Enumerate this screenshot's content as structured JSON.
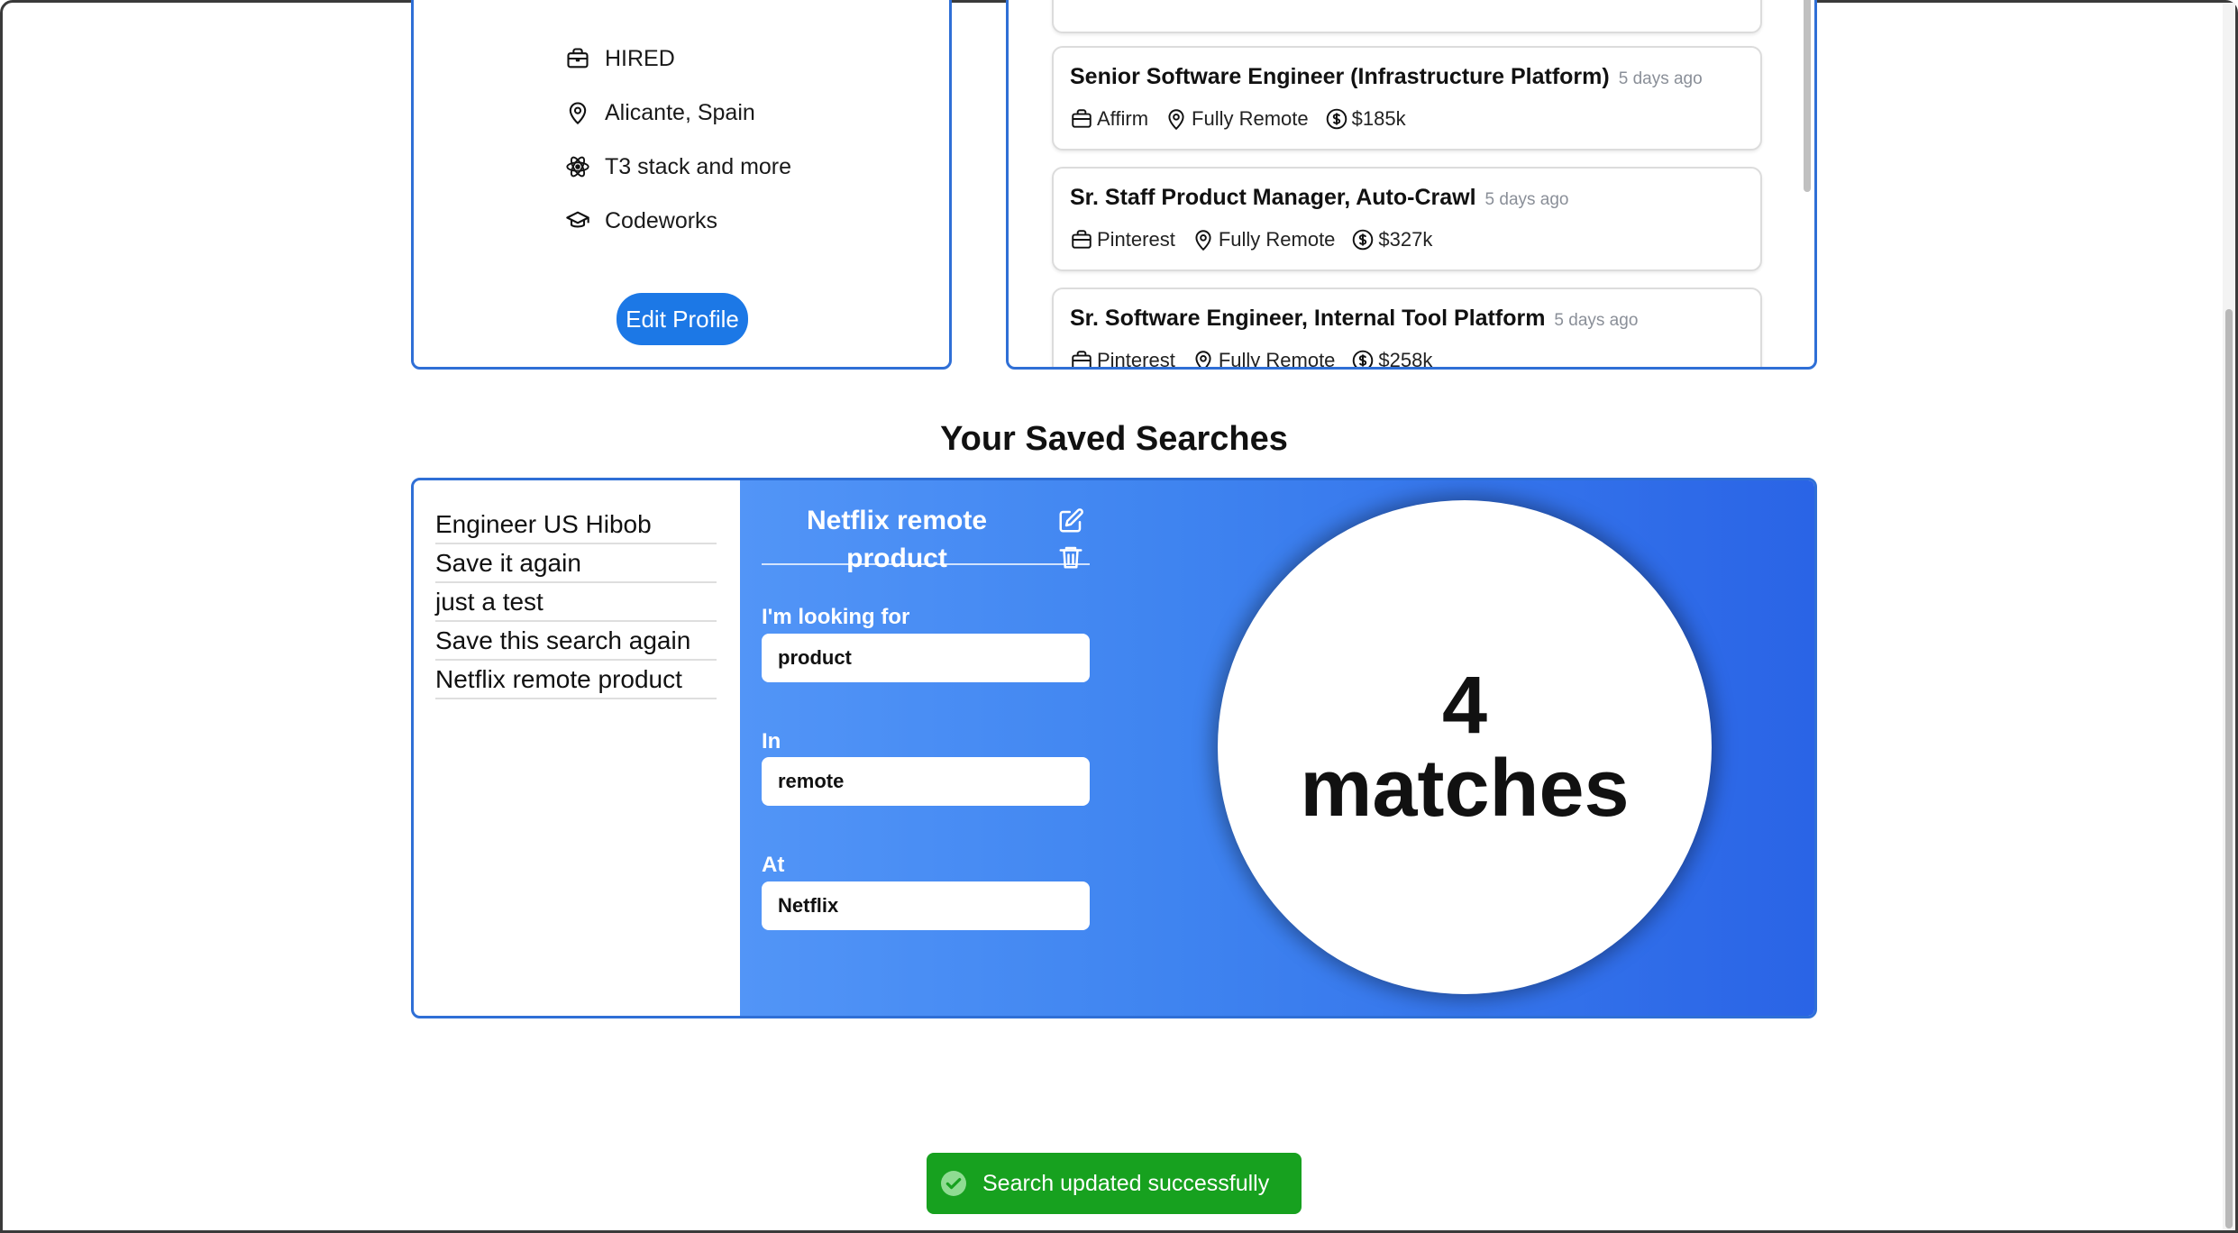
{
  "profile": {
    "items": [
      {
        "icon": "briefcase-icon",
        "label": "HIRED"
      },
      {
        "icon": "map-pin-icon",
        "label": "Alicante, Spain"
      },
      {
        "icon": "atom-icon",
        "label": "T3 stack and more"
      },
      {
        "icon": "graduation-cap-icon",
        "label": "Codeworks"
      }
    ],
    "edit_label": "Edit Profile"
  },
  "jobs": [
    {
      "title": "Senior Software Engineer (Infrastructure Platform)",
      "time": "5 days ago",
      "company": "Affirm",
      "location": "Fully Remote",
      "salary": "$185k"
    },
    {
      "title": "Sr. Staff Product Manager, Auto-Crawl",
      "time": "5 days ago",
      "company": "Pinterest",
      "location": "Fully Remote",
      "salary": "$327k"
    },
    {
      "title": "Sr. Software Engineer, Internal Tool Platform",
      "time": "5 days ago",
      "company": "Pinterest",
      "location": "Fully Remote",
      "salary": "$258k"
    }
  ],
  "saved": {
    "title": "Your Saved Searches",
    "list": [
      "Engineer US Hibob",
      "Save it again",
      "just a test",
      "Save this search again",
      "Netflix remote product"
    ],
    "selected": {
      "title": "Netflix remote product",
      "looking_label": "I'm looking for",
      "looking_value": "product",
      "in_label": "In",
      "in_value": "remote",
      "at_label": "At",
      "at_value": "Netflix",
      "match_count": "4",
      "match_word": "matches"
    }
  },
  "toast": {
    "message": "Search updated successfully",
    "color": "#17a11f"
  },
  "colors": {
    "accent": "#1c78e6",
    "border": "#2f6fd6"
  }
}
